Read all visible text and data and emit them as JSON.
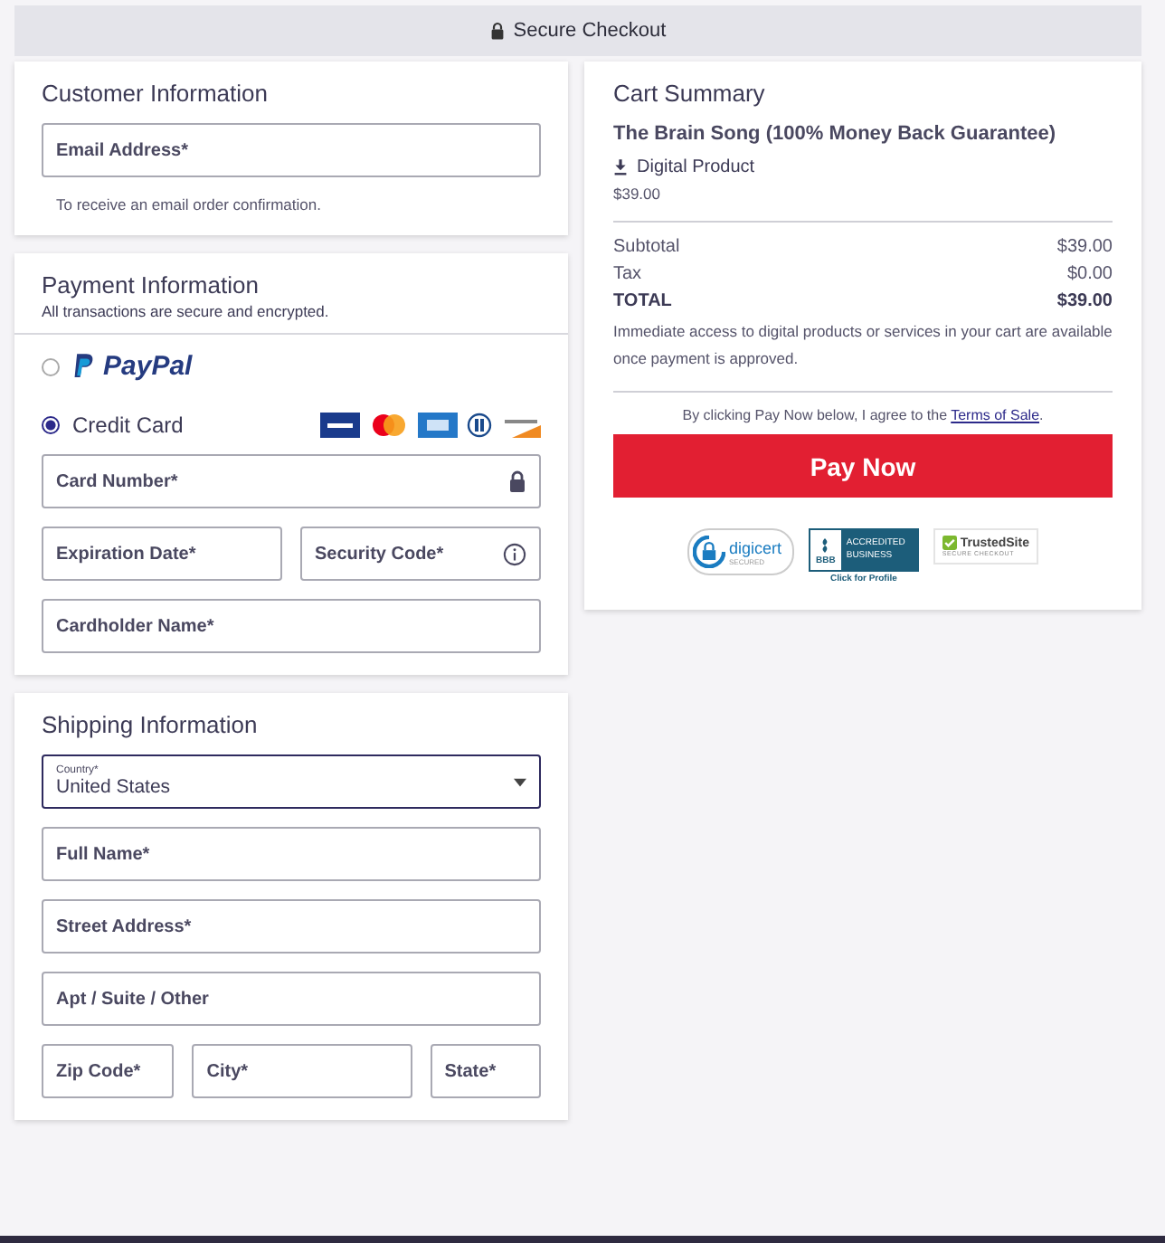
{
  "top_bar": {
    "title": "Secure Checkout"
  },
  "customer": {
    "title": "Customer Information",
    "rows": [
      [
        {
          "kind": "text",
          "label": "Email Address*"
        }
      ]
    ],
    "hint": "To receive an email order confirmation."
  },
  "payment": {
    "title": "Payment Information",
    "subtitle": "All transactions are secure and encrypted.",
    "methods": [
      {
        "kind": "paypal",
        "label": "PayPal",
        "selected": false
      },
      {
        "kind": "card",
        "label": "Credit Card",
        "selected": true
      }
    ],
    "rows": [
      [
        {
          "kind": "secure",
          "label": "Card Number*"
        }
      ],
      [
        {
          "kind": "text",
          "label": "Expiration Date*"
        },
        {
          "kind": "help",
          "label": "Security Code*"
        }
      ],
      [
        {
          "kind": "text",
          "label": "Cardholder Name*"
        }
      ]
    ]
  },
  "shipping": {
    "title": "Shipping Information",
    "rows": [
      [
        {
          "kind": "select",
          "label": "Country*",
          "value": "United States"
        }
      ],
      [
        {
          "kind": "text",
          "label": "Full Name*"
        }
      ],
      [
        {
          "kind": "text",
          "label": "Street Address*"
        }
      ],
      [
        {
          "kind": "text",
          "label": "Apt / Suite / Other"
        }
      ],
      [
        {
          "kind": "text",
          "label": "Zip Code*"
        },
        {
          "kind": "text",
          "label": "City*"
        },
        {
          "kind": "text",
          "label": "State*"
        }
      ]
    ]
  },
  "cart": {
    "title": "Cart Summary",
    "product": "The Brain Song (100% Money Back Guarantee)",
    "product_type": "Digital Product",
    "price": "$39.00",
    "lines": [
      {
        "kind": "normal",
        "label": "Subtotal",
        "amount": "$39.00"
      },
      {
        "kind": "normal",
        "label": "Tax",
        "amount": "$0.00"
      },
      {
        "kind": "total",
        "label": "TOTAL",
        "amount": "$39.00"
      }
    ],
    "note": "Immediate access to digital products or services in your cart are available once payment is approved.",
    "terms_text": "By clicking Pay Now below, I agree to the ",
    "terms_link": "Terms of Sale",
    "terms_end": ".",
    "button": "Pay Now",
    "badges": [
      {
        "kind": "digicert",
        "name": "digicert",
        "sub": "SECURED"
      },
      {
        "kind": "bbb",
        "name": "BBB",
        "sub": "ACCREDITED BUSINESS",
        "caption": "Click for Profile"
      },
      {
        "kind": "trusted",
        "name": "TrustedSite",
        "sub": "SECURE CHECKOUT"
      }
    ]
  }
}
